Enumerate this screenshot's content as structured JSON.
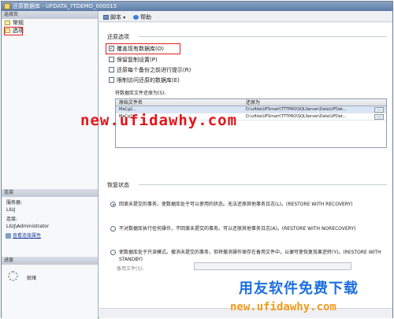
{
  "window": {
    "title": "还原数据库 - UFDATA_?TDEMO_000015"
  },
  "left_pane": {
    "select_page_header": "选择页",
    "pages": [
      {
        "label": "常规"
      },
      {
        "label": "选项"
      }
    ],
    "connection_header": "连接",
    "server_label": "服务器:",
    "server_value": "LIUJ",
    "connection_label": "连接:",
    "connection_value": "LIUJ\\Administrator",
    "view_connection_link": "查看连接属性",
    "progress_header": "进度",
    "progress_status": "就绪"
  },
  "toolbar": {
    "script_label": "脚本",
    "script_arrow": "▾",
    "help_label": "帮助"
  },
  "restore_options": {
    "section_title": "还原选项",
    "overwrite_label": "覆盖现有数据库(O)",
    "overwrite_checked_mark": "✓",
    "keep_replication_label": "保留复制设置(P)",
    "prompt_each_label": "还原每个备份之前进行提示(R)",
    "restrict_access_label": "限制访问还原的数据库(E)"
  },
  "file_grid": {
    "caption": "将数据库文件还原为(S):",
    "col_original": "原始文件名",
    "col_restore_as": "还原为",
    "rows": [
      {
        "original": "MaCg2...",
        "restore_as": "D:\\ufida\\UFSmart\\TTTPRO\\SQLServer\\Data\\UFDat...",
        "browse": "..."
      },
      {
        "original": "MaCg2...",
        "restore_as": "D:\\ufida\\UFSmart\\TTTPRO\\SQLServer\\Data\\UFDat...",
        "browse": "..."
      }
    ]
  },
  "recovery_state": {
    "section_title": "恢复状态",
    "option_recovery": "回滚未提交的事务，使数据库处于可以使用的状态。无法还原其他事务日志(L)。(RESTORE WITH RECOVERY)",
    "option_norecovery": "不对数据库执行任何操作，不回滚未提交的事务。可以还原其他事务日志(A)。(RESTORE WITH NORECOVERY)",
    "option_standby": "使数据库处于只读模式。撤消未提交的事务，但将撤消操作保存在备用文件中，以便可使恢复效果逆转(Y)。(RESTORE WITH STANDBY)",
    "standby_file_label": "备用文件(S):"
  },
  "watermarks": {
    "center": "new.ufidawhy.com",
    "brand_cn": "用友软件免费下载",
    "brand_url": "new.ufidawhy.com"
  }
}
